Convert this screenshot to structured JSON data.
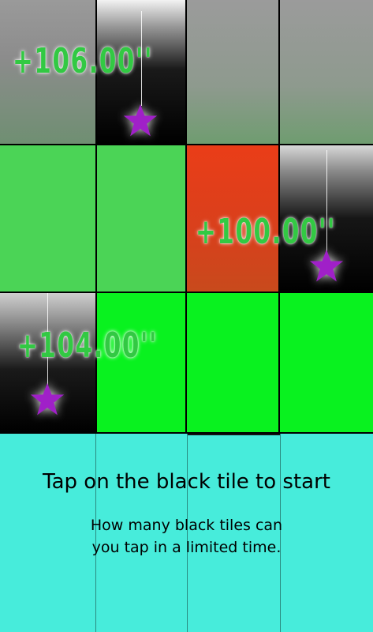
{
  "bonuses": {
    "b1": "+106.00''",
    "b2": "+100.00''",
    "b3": "+104.00''"
  },
  "start_panel": {
    "title": "Tap on the black tile to start",
    "subtitle_line1": "How many black tiles can",
    "subtitle_line2": "you tap in a limited time."
  },
  "colors": {
    "start_panel": "#47ecdb",
    "bright_green": "#09f21f",
    "tapped_red": "#d8401c",
    "star": "#a020c8"
  },
  "icons": [
    "star-icon"
  ]
}
